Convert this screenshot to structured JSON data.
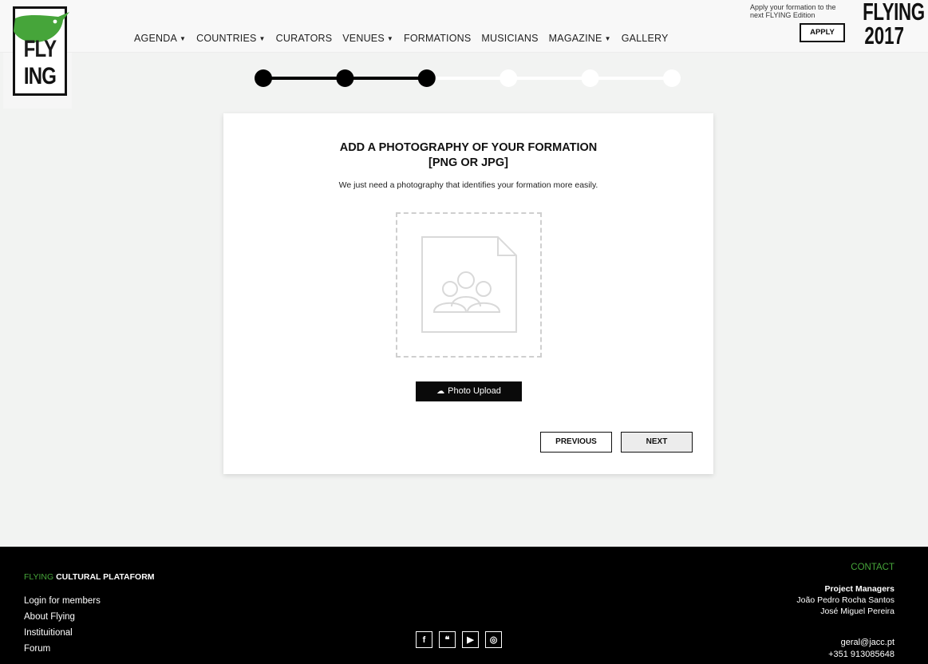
{
  "header": {
    "logo_text_top": "FLY",
    "logo_text_bottom": "ING",
    "nav": [
      {
        "label": "AGENDA",
        "has_caret": true
      },
      {
        "label": "COUNTRIES",
        "has_caret": true
      },
      {
        "label": "CURATORS",
        "has_caret": false
      },
      {
        "label": "VENUES",
        "has_caret": true
      },
      {
        "label": "FORMATIONS",
        "has_caret": false
      },
      {
        "label": "MUSICIANS",
        "has_caret": false
      },
      {
        "label": "MAGAZINE",
        "has_caret": true
      },
      {
        "label": "GALLERY",
        "has_caret": false
      }
    ],
    "apply_text": "Apply your formation to the next FLYING Edition",
    "apply_label": "APPLY",
    "brand_line1": "FLYING",
    "brand_line2": "2017"
  },
  "progress": {
    "total_steps": 6,
    "completed_steps": 3
  },
  "card": {
    "title_line1": "ADD A PHOTOGRAPHY OF YOUR FORMATION",
    "title_line2": "[PNG OR JPG]",
    "subtitle": "We just need a photography that identifies your formation more easily.",
    "upload_label": "Photo Upload",
    "previous_label": "PREVIOUS",
    "next_label": "NEXT"
  },
  "footer": {
    "title_green": "FLYING",
    "title_rest": " CULTURAL PLATAFORM",
    "links": [
      "Login for members",
      "About Flying",
      "Instituitional",
      "Forum"
    ],
    "social": [
      {
        "icon": "facebook-icon",
        "glyph": "f"
      },
      {
        "icon": "twitter-icon",
        "glyph": "❝"
      },
      {
        "icon": "youtube-icon",
        "glyph": "▶"
      },
      {
        "icon": "instagram-icon",
        "glyph": "◎"
      }
    ],
    "contact_heading": "CONTACT",
    "pm_heading": "Project Managers",
    "pm_names": [
      "João Pedro Rocha Santos",
      "José Miguel Pereira"
    ],
    "email": "geral@jacc.pt",
    "phone": "+351 913085648"
  },
  "colors": {
    "brand_green": "#46a53a",
    "dark": "#0a0a0a",
    "page_bg": "#f2f3f2"
  }
}
